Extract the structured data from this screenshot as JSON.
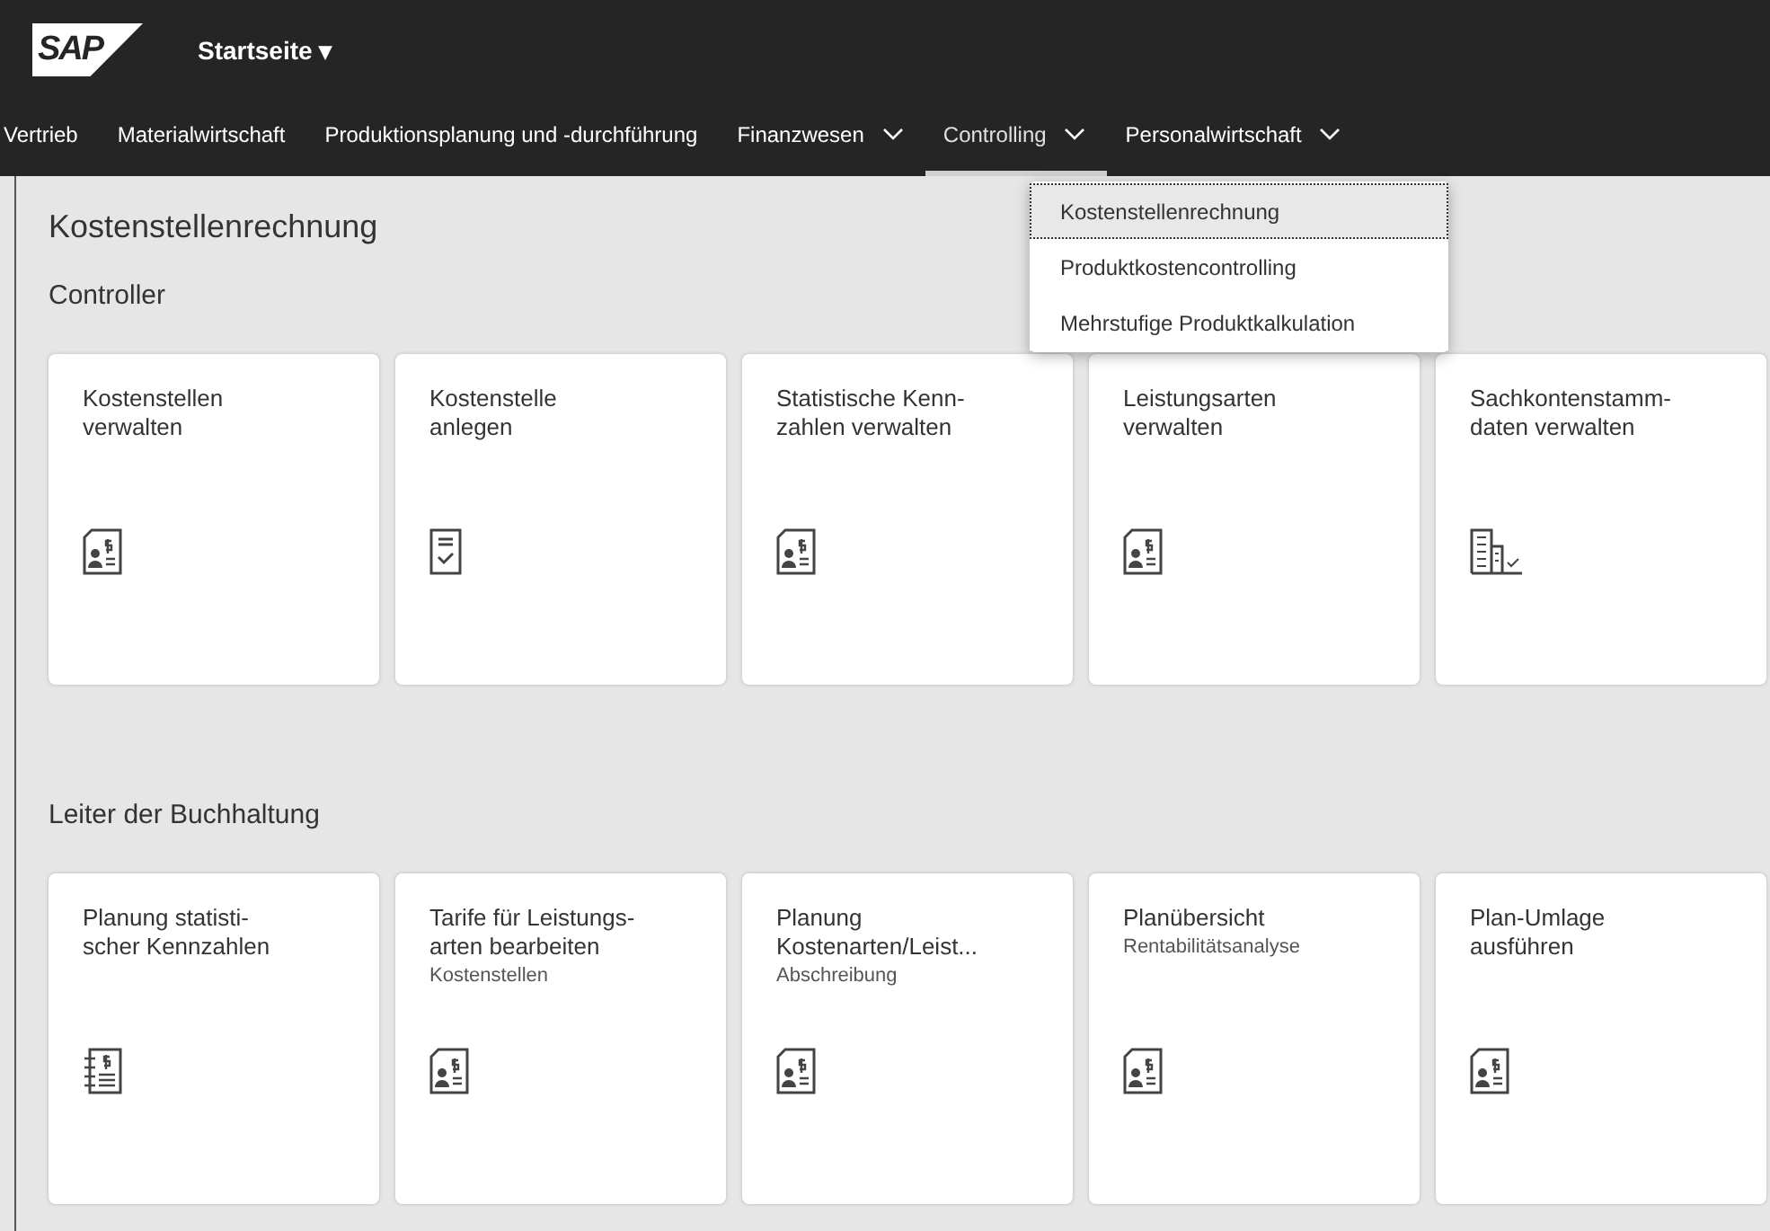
{
  "header": {
    "logo": "SAP",
    "title": "Startseite ▾"
  },
  "nav": [
    {
      "label": "Vertrieb",
      "has_menu": false,
      "selected": false
    },
    {
      "label": "Materialwirtschaft",
      "has_menu": false,
      "selected": false
    },
    {
      "label": "Produktionsplanung und -durchführung",
      "has_menu": false,
      "selected": false
    },
    {
      "label": "Finanzwesen",
      "has_menu": true,
      "selected": false
    },
    {
      "label": "Controlling",
      "has_menu": true,
      "selected": true
    },
    {
      "label": "Personalwirtschaft",
      "has_menu": true,
      "selected": false
    }
  ],
  "menu": [
    {
      "label": "Kostenstellenrechnung",
      "selected": true
    },
    {
      "label": "Produktkostencontrolling",
      "selected": false
    },
    {
      "label": "Mehrstufige Produktkalkulation",
      "selected": false
    }
  ],
  "page_title": "Kostenstellenrechnung",
  "groups": [
    {
      "title": "Controller",
      "tiles": [
        {
          "title": "Kostenstellen\nverwalten",
          "kind": "person-doc"
        },
        {
          "title": "Kostenstelle\nanlegen",
          "kind": "checklist"
        },
        {
          "title": "Statistische Kenn-\nzahlen verwalten",
          "kind": "person-doc"
        },
        {
          "title": "Leistungsarten\nverwalten",
          "kind": "person-doc"
        },
        {
          "title": "Sachkontenstamm-\ndaten verwalten",
          "kind": "building"
        }
      ]
    },
    {
      "title": "Leiter der Buchhaltung",
      "tiles": [
        {
          "title": "Planung statisti-\nscher Kennzahlen",
          "kind": "notebook"
        },
        {
          "title": "Tarife für Leistungs-\narten bearbeiten",
          "subtitle": "Kostenstellen",
          "kind": "person-doc"
        },
        {
          "title": "Planung\nKostenarten/Leist...",
          "subtitle": "Abschreibung",
          "kind": "person-doc"
        },
        {
          "title": "Planübersicht",
          "subtitle": "Rentabilitätsanalyse",
          "kind": "person-doc"
        },
        {
          "title": "Plan-Umlage\nausführen",
          "kind": "person-doc"
        }
      ]
    }
  ]
}
